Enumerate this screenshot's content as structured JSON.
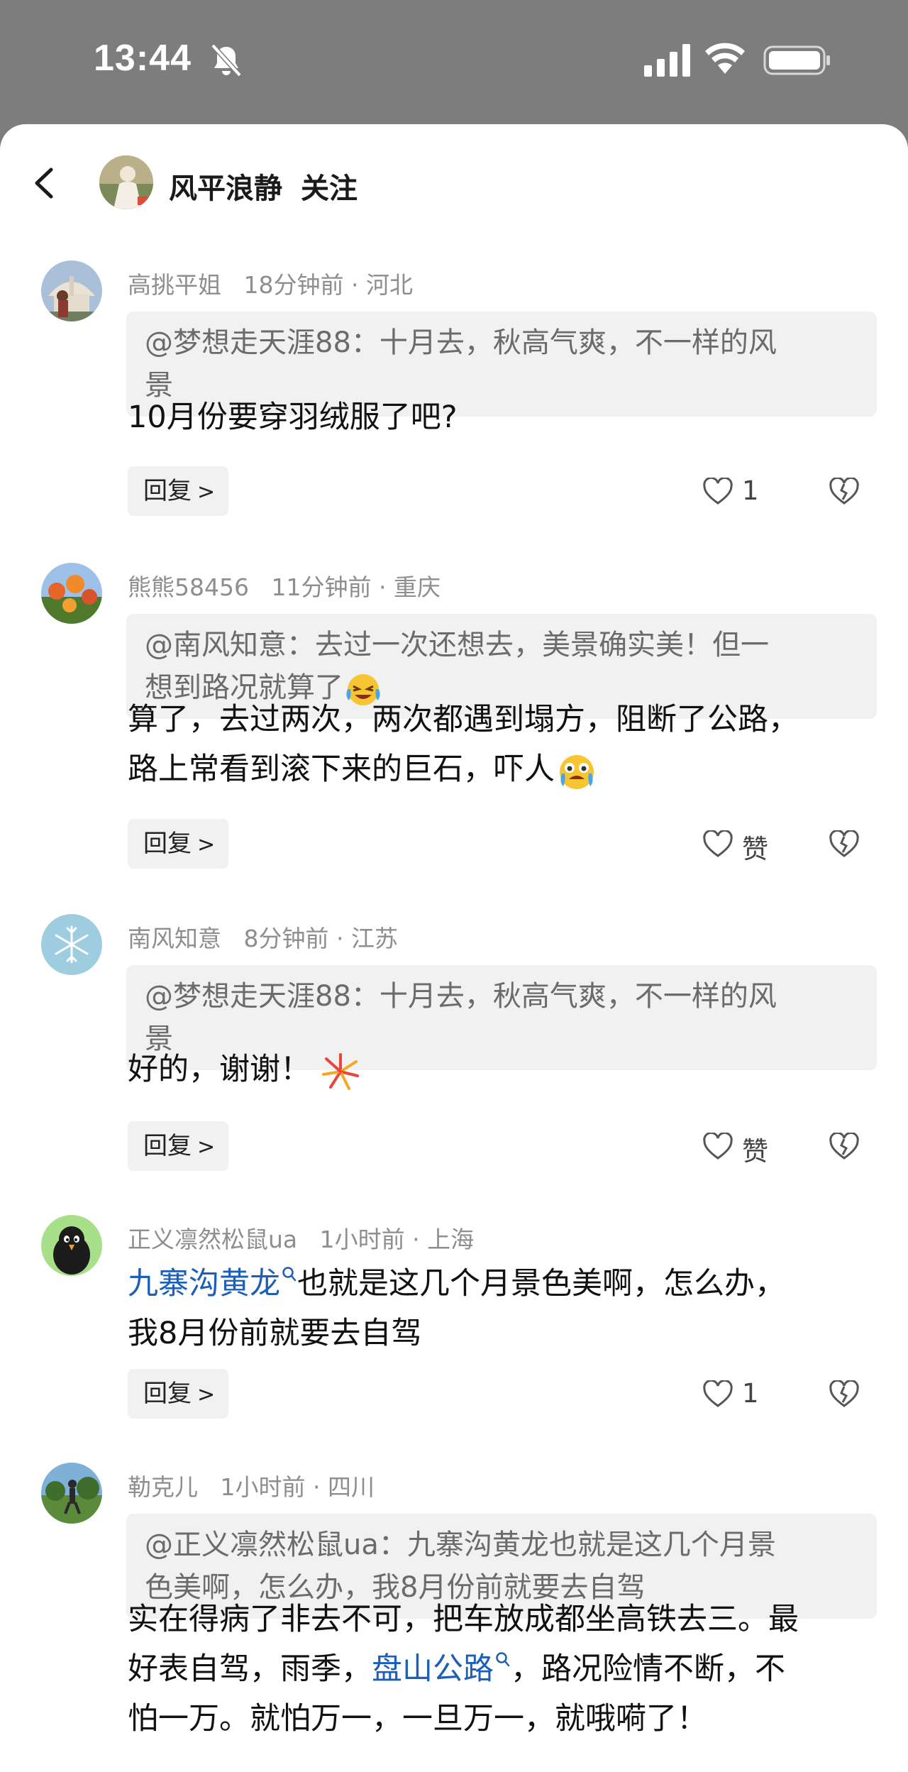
{
  "status_bar": {
    "time": "13:44"
  },
  "header": {
    "author": "风平浪静",
    "follow": "关注"
  },
  "comments": [
    {
      "user": "高挑平姐",
      "time": "18分钟前",
      "region": "河北",
      "quote_line1": "@梦想走天涯88：十月去，秋高气爽，不一样的风",
      "quote_line2": "景",
      "body_line1": "10月份要穿羽绒服了吧?",
      "reply": "回复",
      "likes": "1"
    },
    {
      "user": "熊熊58456",
      "time": "11分钟前",
      "region": "重庆",
      "quote_line1": "@南风知意：去过一次还想去，美景确实美！但一",
      "quote_line2": "想到路况就算了",
      "body_line1": "算了，去过两次，两次都遇到塌方，阻断了公路，",
      "body_line2": "路上常看到滚下来的巨石，吓人",
      "reply": "回复",
      "likes": "赞"
    },
    {
      "user": "南风知意",
      "time": "8分钟前",
      "region": "江苏",
      "quote_line1": "@梦想走天涯88：十月去，秋高气爽，不一样的风",
      "quote_line2": "景",
      "body_line1": "好的，谢谢！",
      "reply": "回复",
      "likes": "赞"
    },
    {
      "user": "正义凛然松鼠ua",
      "time": "1小时前",
      "region": "上海",
      "body_link": "九寨沟黄龙",
      "body_line1_rest": "也就是这几个月景色美啊，怎么办，",
      "body_line2": "我8月份前就要去自驾",
      "reply": "回复",
      "likes": "1"
    },
    {
      "user": "勒克儿",
      "time": "1小时前",
      "region": "四川",
      "quote_line1": "@正义凛然松鼠ua：九寨沟黄龙也就是这几个月景",
      "quote_line2": "色美啊，怎么办，我8月份前就要去自驾",
      "body_line1": "实在得病了非去不可，把车放成都坐高铁去三。最",
      "body_line2_a": "好表自驾，雨季，",
      "body_link": "盘山公路",
      "body_line2_b": "，路况险情不断，不",
      "body_line3": "怕一万。就怕万一，一旦万一，就哦嗬了！"
    }
  ],
  "meta_separator": "·"
}
